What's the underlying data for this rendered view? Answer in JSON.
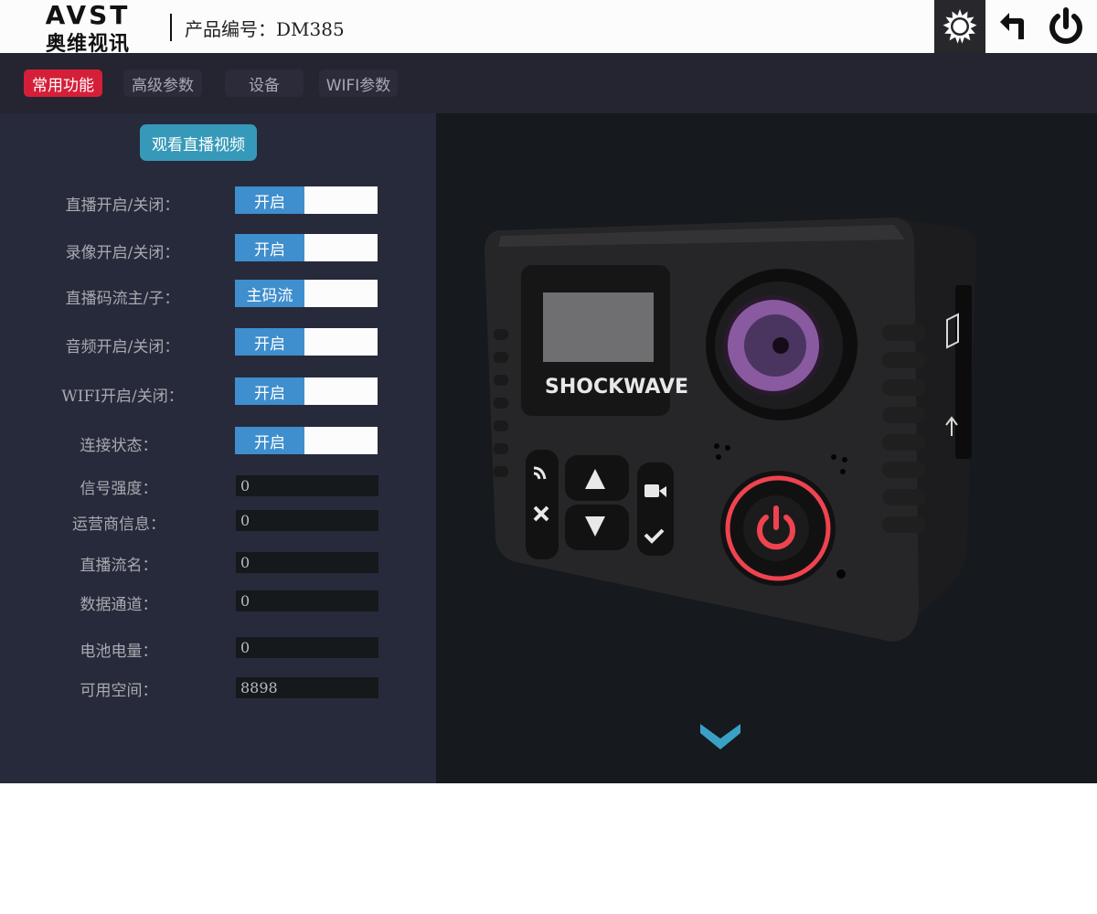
{
  "header": {
    "logo_en": "AVST",
    "logo_cn": "奥维视讯",
    "product_label": "产品编号：",
    "product_code": "DM385",
    "icons": [
      "settings-gear-icon",
      "back-arrow-icon",
      "power-icon"
    ]
  },
  "tabs": [
    {
      "label": "常用功能",
      "active": true
    },
    {
      "label": "高级参数",
      "active": false
    },
    {
      "label": "设备",
      "active": false
    },
    {
      "label": "WIFI参数",
      "active": false
    }
  ],
  "left": {
    "watch_button": "观看直播视频",
    "toggles": [
      {
        "label": "直播开启/关闭：",
        "value": "开启"
      },
      {
        "label": "录像开启/关闭：",
        "value": "开启"
      },
      {
        "label": "直播码流主/子：",
        "value": "主码流"
      },
      {
        "label": "音频开启/关闭：",
        "value": "开启"
      },
      {
        "label": "WIFI开启/关闭：",
        "value": "开启"
      },
      {
        "label": "连接状态：",
        "value": "开启"
      }
    ],
    "fields": [
      {
        "label": "信号强度：",
        "value": "0"
      },
      {
        "label": "运营商信息：",
        "value": "0"
      },
      {
        "label": "直播流名：",
        "value": "0"
      },
      {
        "label": "数据通道：",
        "value": "0"
      },
      {
        "label": "电池电量：",
        "value": "0"
      },
      {
        "label": "可用空间：",
        "value": "8898"
      }
    ]
  },
  "device": {
    "brand_text": "SHOCKWAVE"
  },
  "colors": {
    "accent_red": "#d51f39",
    "toggle_blue": "#3f8ecd",
    "button_teal": "#3699b9",
    "panel_left": "#272a3a",
    "panel_right": "#16191d"
  }
}
